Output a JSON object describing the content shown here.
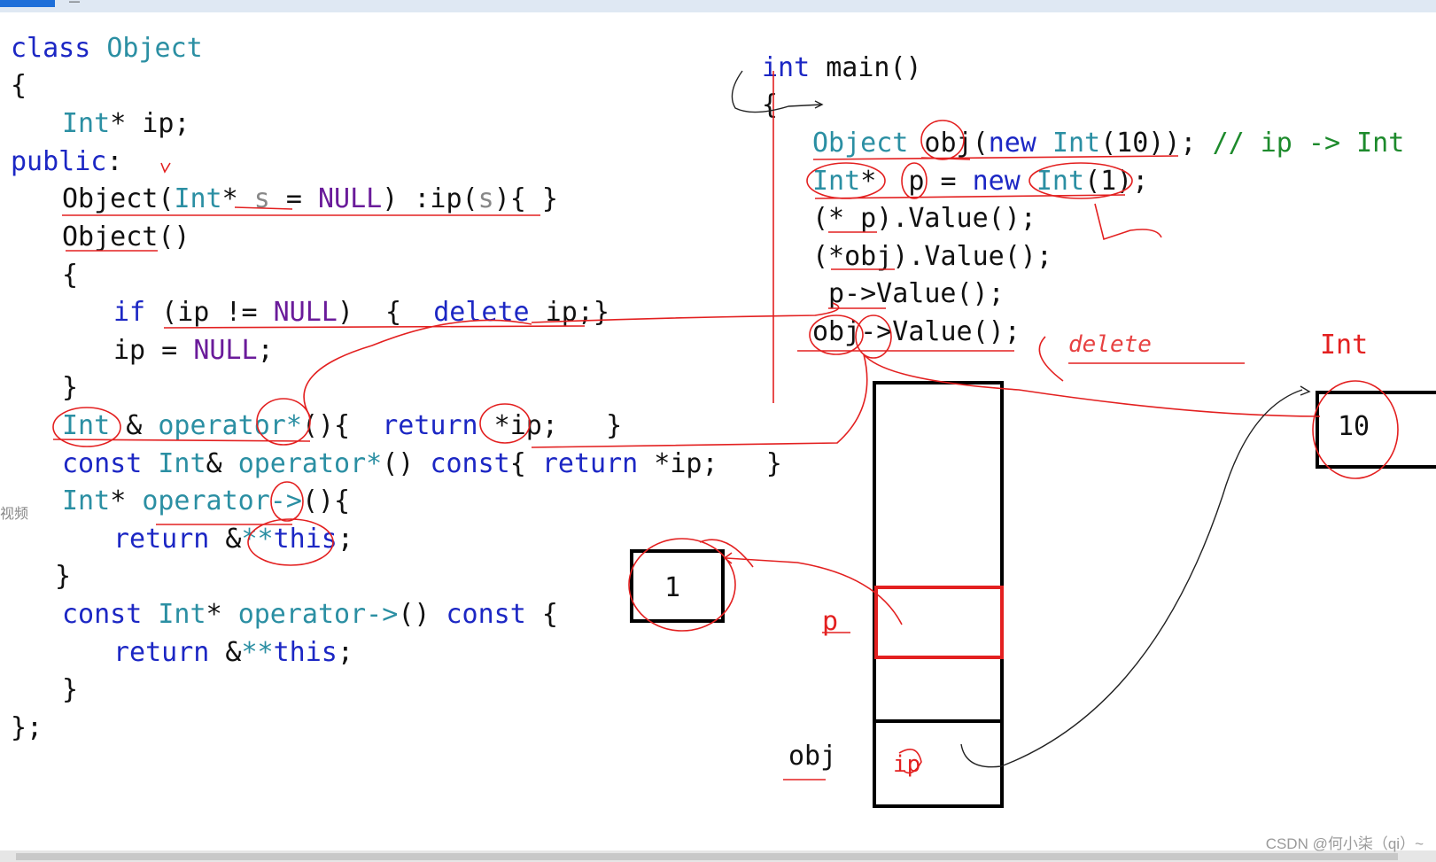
{
  "window": {
    "tab_text": "—"
  },
  "side_label": "视频",
  "code_left": {
    "l1": {
      "a": "class",
      "b": "Object"
    },
    "l2": "{",
    "l3": {
      "a": "Int",
      "b": "* ip;"
    },
    "l4": {
      "a": "public",
      "b": ":"
    },
    "l5": {
      "a": "Object(",
      "b": "Int",
      "c": "*",
      "d": " s",
      "e": " = ",
      "f": "NULL",
      "g": ") :ip(",
      "h": "s",
      "i": "){ }"
    },
    "l6": "Object()",
    "l7": "{",
    "l8": {
      "a": "if",
      "b": " (ip != ",
      "c": "NULL",
      "d": ")  {  ",
      "e": "delete",
      "f": " ip;}"
    },
    "l9": {
      "a": "ip = ",
      "b": "NULL",
      "c": ";"
    },
    "l10": "}",
    "l11": {
      "a": "Int",
      "b": " & ",
      "c": "operator*",
      "d": "(){  ",
      "e": "return",
      "f": " *ip;   }"
    },
    "l12": {
      "a": "const",
      "b": " ",
      "c": "Int",
      "d": "& ",
      "e": "operator*",
      "f": "() ",
      "g": "const",
      "h": "{ ",
      "i": "return",
      "j": " *ip;   }"
    },
    "l13": {
      "a": "Int",
      "b": "* ",
      "c": "operator->",
      "d": "(){"
    },
    "l14": {
      "a": "return",
      "b": " &",
      "c": "**",
      "d": "this",
      "e": ";"
    },
    "l15": "}",
    "l16": {
      "a": "const",
      "b": " ",
      "c": "Int",
      "d": "* ",
      "e": "operator->",
      "f": "() ",
      "g": "const",
      "h": " {"
    },
    "l17": {
      "a": "return",
      "b": " &",
      "c": "**",
      "d": "this",
      "e": ";"
    },
    "l18": "}",
    "l19": "};"
  },
  "code_right": {
    "r1": {
      "a": "int",
      "b": " main()"
    },
    "r2": "{",
    "r3": {
      "a": "Object",
      "b": " obj(",
      "c": "new",
      "d": " ",
      "e": "Int",
      "f": "(10)); ",
      "g": "// ip -> Int"
    },
    "r4": {
      "a": "Int",
      "b": "*  p = ",
      "c": "new",
      "d": " ",
      "e": "Int",
      "f": "(1);"
    },
    "r5": "(* p).Value();",
    "r6": "(*obj).Value();",
    "r7": "p->Value();",
    "r8": "obj->Value();"
  },
  "diagram": {
    "int_label": "Int",
    "heap_int_value": "10",
    "heap_one_value": "1",
    "p_label": "p",
    "obj_label": "obj",
    "ip_label": "ip",
    "delete_scribble": "delete"
  },
  "credit": "CSDN @何小柒（qi）~"
}
